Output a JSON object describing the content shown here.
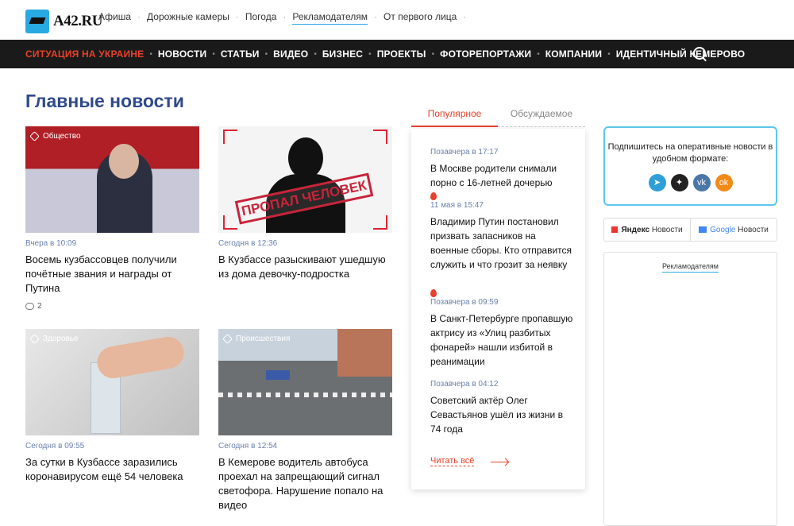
{
  "logo": {
    "text": "А42.RU"
  },
  "toplinks": [
    "Афиша",
    "Дорожные камеры",
    "Погода",
    "Рекламодателям",
    "От первого лица"
  ],
  "navbar": {
    "items": [
      "СИТУАЦИЯ НА УКРАИНЕ",
      "НОВОСТИ",
      "СТАТЬИ",
      "ВИДЕО",
      "БИЗНЕС",
      "ПРОЕКТЫ",
      "ФОТОРЕПОРТАЖИ",
      "КОМПАНИИ",
      "ИДЕНТИЧНЫЙ КЕМЕРОВО"
    ]
  },
  "main": {
    "title": "Главные новости",
    "cards": [
      {
        "tag": "Общество",
        "time": "Вчера в 10:09",
        "title": "Восемь кузбассовцев получили почётные звания и награды от Путина",
        "comments": "2"
      },
      {
        "tag": "",
        "time": "Сегодня в 12:36",
        "title": "В Кузбассе разыскивают ушедшую из дома девочку-подростка",
        "image_text": "ПРОПАЛ ЧЕЛОВЕК"
      },
      {
        "tag": "Здоровье",
        "time": "Сегодня в 09:55",
        "title": "За сутки в Кузбассе заразились коронавирусом ещё 54 человека"
      },
      {
        "tag": "Происшествия",
        "time": "Сегодня в 12:54",
        "title": "В Кемерове водитель автобуса проехал на запрещающий сигнал светофора. Нарушение попало на видео"
      }
    ]
  },
  "popular": {
    "tabs": [
      "Популярное",
      "Обсуждаемое"
    ],
    "items": [
      {
        "time": "Позавчера в 17:17",
        "title": "В Москве родители снимали порно с 16-летней дочерью"
      },
      {
        "time": "11 мая в 15:47",
        "title": "Владимир Путин постановил призвать запасников на военные сборы. Кто отправится служить и что грозит за неявку"
      },
      {
        "time": "Позавчера в 09:59",
        "title": "В Санкт-Петербурге пропавшую актрису из «Улиц разбитых фонарей» нашли избитой в реанимации"
      },
      {
        "time": "Позавчера в 04:12",
        "title": "Советский актёр Олег Севастьянов ушёл из жизни в 74 года"
      }
    ],
    "read_all": "Читать всё"
  },
  "sidebar": {
    "subscribe_text": "Подпишитесь на оперативные новости в удобном формате:",
    "yandex": {
      "brand": "Яндекс",
      "label": "Новости"
    },
    "google": {
      "brand": "Google",
      "label": "Новости"
    },
    "ad_label": "Рекламодателям"
  },
  "colors": {
    "accent_red": "#e8412b",
    "title_blue": "#2f4a8a",
    "time_blue": "#6a7fb0",
    "nav_bg": "#1a1a1a",
    "border_cyan": "#5bc6ec"
  }
}
